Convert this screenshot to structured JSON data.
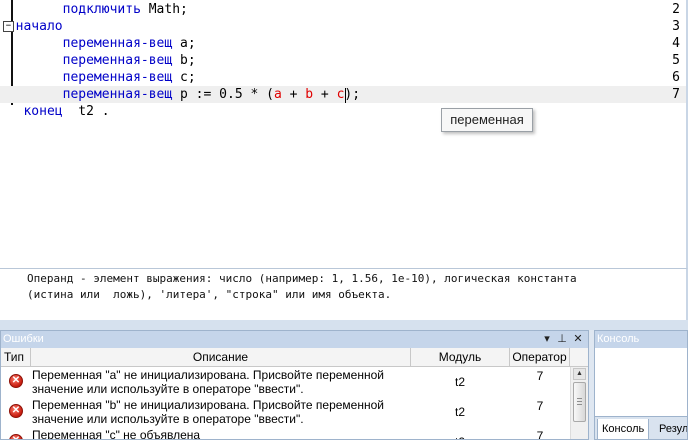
{
  "editor": {
    "lines": [
      {
        "num": "2",
        "indent": "        ",
        "parts": [
          {
            "t": "подключить",
            "c": "kw"
          },
          {
            "t": " Math;",
            "c": "plain"
          }
        ]
      },
      {
        "num": "3",
        "indent": "  ",
        "parts": [
          {
            "t": "начало",
            "c": "kw"
          }
        ]
      },
      {
        "num": "4",
        "indent": "        ",
        "parts": [
          {
            "t": "переменная-вещ",
            "c": "kw"
          },
          {
            "t": " a;",
            "c": "plain"
          }
        ]
      },
      {
        "num": "5",
        "indent": "        ",
        "parts": [
          {
            "t": "переменная-вещ",
            "c": "kw"
          },
          {
            "t": " b;",
            "c": "plain"
          }
        ]
      },
      {
        "num": "6",
        "indent": "        ",
        "parts": [
          {
            "t": "переменная-вещ",
            "c": "kw"
          },
          {
            "t": " c;",
            "c": "plain"
          }
        ]
      },
      {
        "num": "7",
        "indent": "        ",
        "current": true,
        "parts": [
          {
            "t": "переменная-вещ",
            "c": "kw"
          },
          {
            "t": " p := 0.5 * (",
            "c": "plain"
          },
          {
            "t": "a",
            "c": "var-red"
          },
          {
            "t": " + ",
            "c": "plain"
          },
          {
            "t": "b",
            "c": "var-red"
          },
          {
            "t": " + ",
            "c": "plain"
          },
          {
            "t": "c",
            "c": "var-red"
          },
          {
            "t": ");",
            "c": "plain"
          }
        ]
      },
      {
        "num": "",
        "indent": "   ",
        "parts": [
          {
            "t": "конец",
            "c": "kw"
          },
          {
            "t": "  t2 .",
            "c": "plain"
          }
        ]
      }
    ],
    "tooltip": "переменная"
  },
  "hint": {
    "line1": "Операнд - элемент выражения: число (например: 1, 1.56, 1e-10), логическая константа",
    "line2": "(истина или  ложь), 'литера', \"строка\" или имя объекта."
  },
  "errors_panel": {
    "title": "Ошибки",
    "pin_glyph": "⊥",
    "close_glyph": "✕",
    "dropdown_glyph": "▾",
    "columns": [
      "Тип",
      "Описание",
      "Модуль",
      "Оператор"
    ],
    "rows": [
      {
        "description": "Переменная \"a\" не инициализирована. Присвойте переменной значение или используйте в операторе \"ввести\".",
        "module": "t2",
        "operator": "7"
      },
      {
        "description": "Переменная \"b\" не инициализирована. Присвойте переменной значение или используйте в операторе \"ввести\".",
        "module": "t2",
        "operator": "7"
      },
      {
        "description": "Переменная \"c\" не объявлена",
        "module": "t2",
        "operator": "7"
      }
    ],
    "error_glyph": "✕"
  },
  "console_panel": {
    "title": "Консоль",
    "tabs": [
      "Консоль",
      "Резул"
    ]
  },
  "colors": {
    "keyword": "#0000c8",
    "identifier_red": "#e00000",
    "panel_header": "#c5d5ea",
    "error_icon": "#c51b0e"
  }
}
